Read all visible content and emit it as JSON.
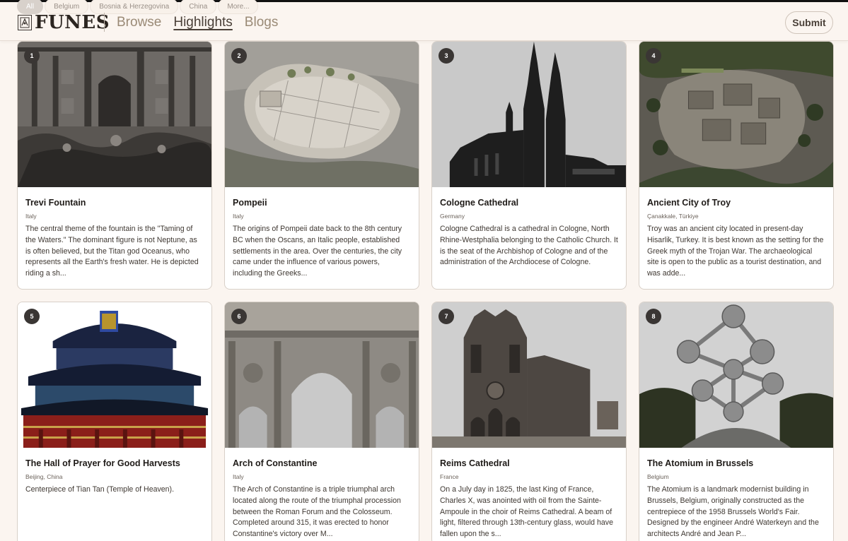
{
  "filters": [
    "All",
    "Belgium",
    "Bosnia & Herzegovina",
    "China",
    "More..."
  ],
  "brand": {
    "name": "FUNES"
  },
  "nav": [
    {
      "label": "Browse"
    },
    {
      "label": "Highlights"
    },
    {
      "label": "Blogs"
    }
  ],
  "submit_label": "Submit",
  "cards": [
    {
      "number": "1",
      "title": "Trevi Fountain",
      "location": "Italy",
      "description": "The central theme of the fountain is the \"Taming of the Waters.\" The dominant figure is not Neptune, as is often believed, but the Titan god Oceanus, who represents all the Earth's fresh water. He is depicted riding a sh..."
    },
    {
      "number": "2",
      "title": "Pompeii",
      "location": "Italy",
      "description": "The origins of Pompeii date back to the 8th century BC when the Oscans, an Italic people, established settlements in the area. Over the centuries, the city came under the influence of various powers, including the Greeks..."
    },
    {
      "number": "3",
      "title": "Cologne Cathedral",
      "location": "Germany",
      "description": "Cologne Cathedral is a cathedral in Cologne, North Rhine-Westphalia belonging to the Catholic Church. It is the seat of the Archbishop of Cologne and of the administration of the Archdiocese of Cologne."
    },
    {
      "number": "4",
      "title": "Ancient City of Troy",
      "location": "Çanakkale, Türkiye",
      "description": "Troy was an ancient city located in present-day Hisarlik, Turkey. It is best known as the setting for the Greek myth of the Trojan War. The archaeological site is open to the public as a tourist destination, and was adde..."
    },
    {
      "number": "5",
      "title": "The Hall of Prayer for Good Harvests",
      "location": "Beijing, China",
      "description": "Centerpiece of Tian Tan (Temple of Heaven)."
    },
    {
      "number": "6",
      "title": "Arch of Constantine",
      "location": "Italy",
      "description": "The Arch of Constantine is a triple triumphal arch located along the route of the triumphal procession between the Roman Forum and the Colosseum. Completed around 315, it was erected to honor Constantine's victory over M..."
    },
    {
      "number": "7",
      "title": "Reims Cathedral",
      "location": "France",
      "description": "On a July day in 1825, the last King of France, Charles X, was anointed with oil from the Sainte-Ampoule in the choir of Reims Cathedral. A beam of light, filtered through 13th-century glass, would have fallen upon the s..."
    },
    {
      "number": "8",
      "title": "The Atomium in Brussels",
      "location": "Belgium",
      "description": "The Atomium is a landmark modernist building in Brussels, Belgium, originally constructed as the centrepiece of the 1958 Brussels World's Fair. Designed by the engineer André Waterkeyn and the architects André and Jean P..."
    }
  ]
}
